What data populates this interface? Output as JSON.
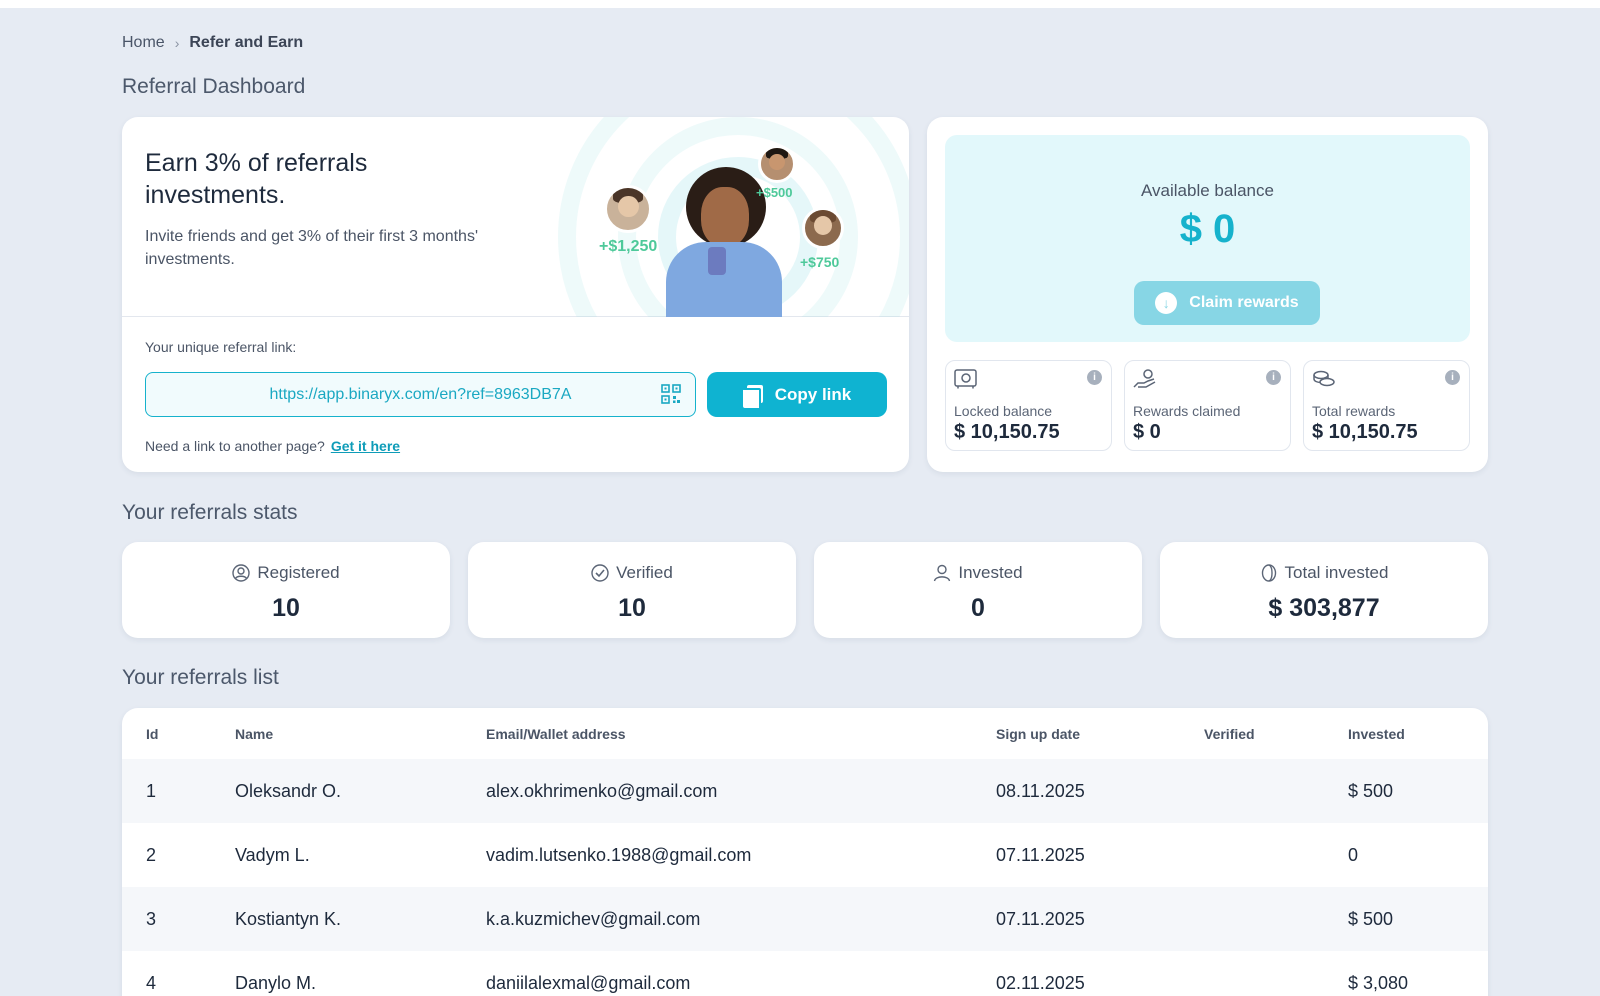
{
  "breadcrumb": {
    "home": "Home",
    "separator": "›",
    "current": "Refer and Earn"
  },
  "page_title": "Referral Dashboard",
  "earn_card": {
    "heading": "Earn 3% of referrals investments.",
    "subtext": "Invite friends and get 3% of their first 3 months' investments.",
    "bonuses": {
      "a": "+$1,250",
      "b": "+$500",
      "c": "+$750"
    },
    "link_label": "Your unique referral link:",
    "referral_link": "https://app.binaryx.com/en?ref=8963DB7A",
    "copy_label": "Copy link",
    "another_text": "Need a link to another page?",
    "another_link": "Get it here"
  },
  "balance_card": {
    "label": "Available balance",
    "value": "$ 0",
    "claim_label": "Claim rewards",
    "info_glyph": "i",
    "minis": [
      {
        "label": "Locked balance",
        "value": "$ 10,150.75",
        "icon": "safe-icon"
      },
      {
        "label": "Rewards claimed",
        "value": "$ 0",
        "icon": "hand-coin-icon"
      },
      {
        "label": "Total rewards",
        "value": "$ 10,150.75",
        "icon": "coins-icon"
      }
    ]
  },
  "stats_title": "Your referrals stats",
  "stats": [
    {
      "label": "Registered",
      "value": "10",
      "icon": "user-circle-icon"
    },
    {
      "label": "Verified",
      "value": "10",
      "icon": "check-badge-icon"
    },
    {
      "label": "Invested",
      "value": "0",
      "icon": "user-icon"
    },
    {
      "label": "Total invested",
      "value": "$ 303,877",
      "icon": "coin-icon"
    }
  ],
  "list_title": "Your referrals list",
  "table": {
    "headers": {
      "id": "Id",
      "name": "Name",
      "email": "Email/Wallet address",
      "date": "Sign up date",
      "verified": "Verified",
      "invested": "Invested"
    },
    "rows": [
      {
        "id": "1",
        "name": "Oleksandr O.",
        "email": "alex.okhrimenko@gmail.com",
        "date": "08.11.2025",
        "verified": "",
        "invested": "$ 500"
      },
      {
        "id": "2",
        "name": "Vadym L.",
        "email": "vadim.lutsenko.1988@gmail.com",
        "date": "07.11.2025",
        "verified": "",
        "invested": "0"
      },
      {
        "id": "3",
        "name": "Kostiantyn K.",
        "email": "k.a.kuzmichev@gmail.com",
        "date": "07.11.2025",
        "verified": "",
        "invested": "$ 500"
      },
      {
        "id": "4",
        "name": "Danylo M.",
        "email": "daniilalexmal@gmail.com",
        "date": "02.11.2025",
        "verified": "",
        "invested": "$ 3,080"
      }
    ]
  },
  "colors": {
    "accent": "#0fb3d1",
    "accent_light": "#e2f8fb",
    "bonus": "#4ec99a",
    "background": "#e6ebf3"
  }
}
